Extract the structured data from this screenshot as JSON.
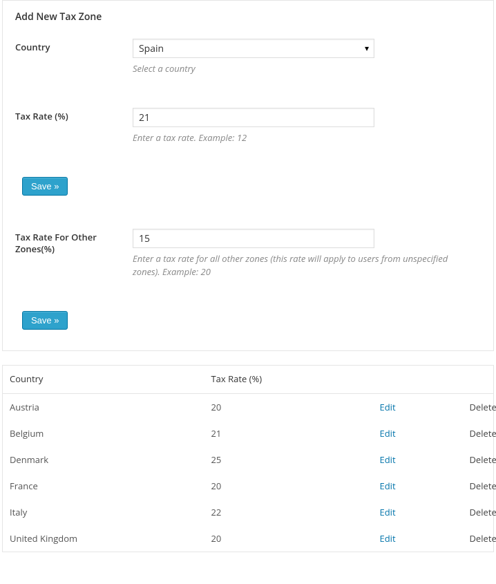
{
  "form": {
    "title": "Add New Tax Zone",
    "country": {
      "label": "Country",
      "value": "Spain",
      "helper": "Select a country"
    },
    "taxRate": {
      "label": "Tax Rate (%)",
      "value": "21",
      "helper": "Enter a tax rate. Example: 12"
    },
    "saveLabel": "Save »",
    "otherZones": {
      "label": "Tax Rate For Other Zones(%)",
      "value": "15",
      "helper": "Enter a tax rate for all other zones (this rate will apply to users from unspecified zones). Example: 20"
    },
    "saveLabel2": "Save »"
  },
  "table": {
    "headers": {
      "country": "Country",
      "rate": "Tax Rate (%)"
    },
    "actions": {
      "edit": "Edit",
      "delete": "Delete"
    },
    "rows": [
      {
        "country": "Austria",
        "rate": "20"
      },
      {
        "country": "Belgium",
        "rate": "21"
      },
      {
        "country": "Denmark",
        "rate": "25"
      },
      {
        "country": "France",
        "rate": "20"
      },
      {
        "country": "Italy",
        "rate": "22"
      },
      {
        "country": "United Kingdom",
        "rate": "20"
      }
    ]
  }
}
